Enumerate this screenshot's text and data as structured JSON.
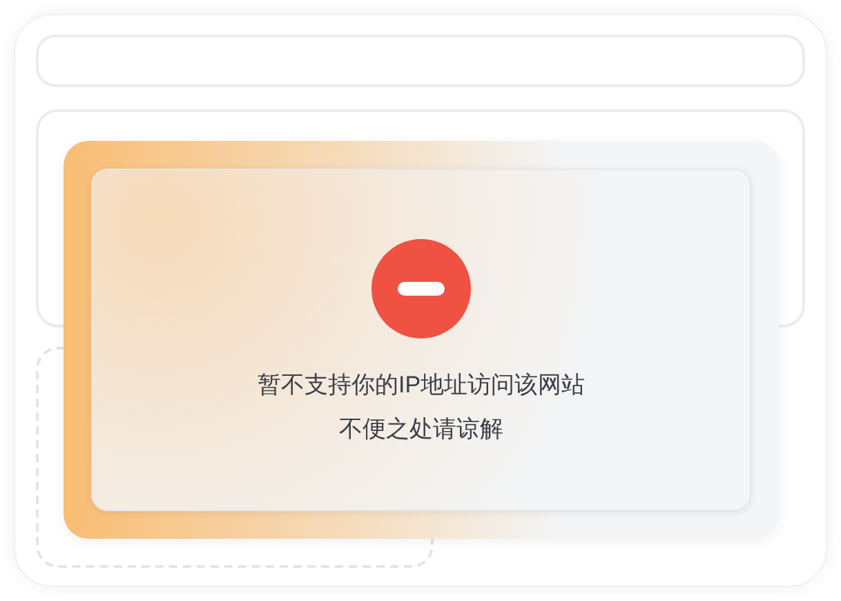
{
  "notice": {
    "kind": "blocked",
    "lines": [
      "暂不支持你的IP地址访问该网站",
      "不便之处请谅解"
    ]
  }
}
